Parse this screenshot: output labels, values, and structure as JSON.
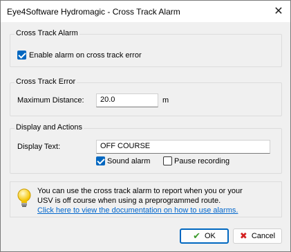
{
  "window": {
    "title": "Eye4Software Hydromagic - Cross Track Alarm"
  },
  "groups": {
    "cross_track_alarm": {
      "label": "Cross Track Alarm",
      "enable_label": "Enable alarm on cross track error",
      "enable_checked": true
    },
    "cross_track_error": {
      "label": "Cross Track Error",
      "max_distance_label": "Maximum Distance:",
      "max_distance_value": "20.0",
      "unit": "m"
    },
    "display_actions": {
      "label": "Display and Actions",
      "display_text_label": "Display Text:",
      "display_text_value": "OFF COURSE",
      "sound_alarm_label": "Sound alarm",
      "sound_alarm_checked": true,
      "pause_recording_label": "Pause recording",
      "pause_recording_checked": false
    }
  },
  "info": {
    "line1": "You can use the cross track alarm to report when you or your",
    "line2": "USV is off course when using a preprogrammed route.",
    "link": "Click here to view the documentation on how to use alarms."
  },
  "buttons": {
    "ok": "OK",
    "cancel": "Cancel"
  },
  "icons": {
    "info": "lightbulb-icon",
    "ok": "checkmark-icon",
    "cancel": "x-icon",
    "close": "close-icon"
  },
  "colors": {
    "accent": "#0067c0",
    "link": "#0066cc",
    "ok_icon": "#3a9a2a",
    "cancel_icon": "#d42020"
  }
}
